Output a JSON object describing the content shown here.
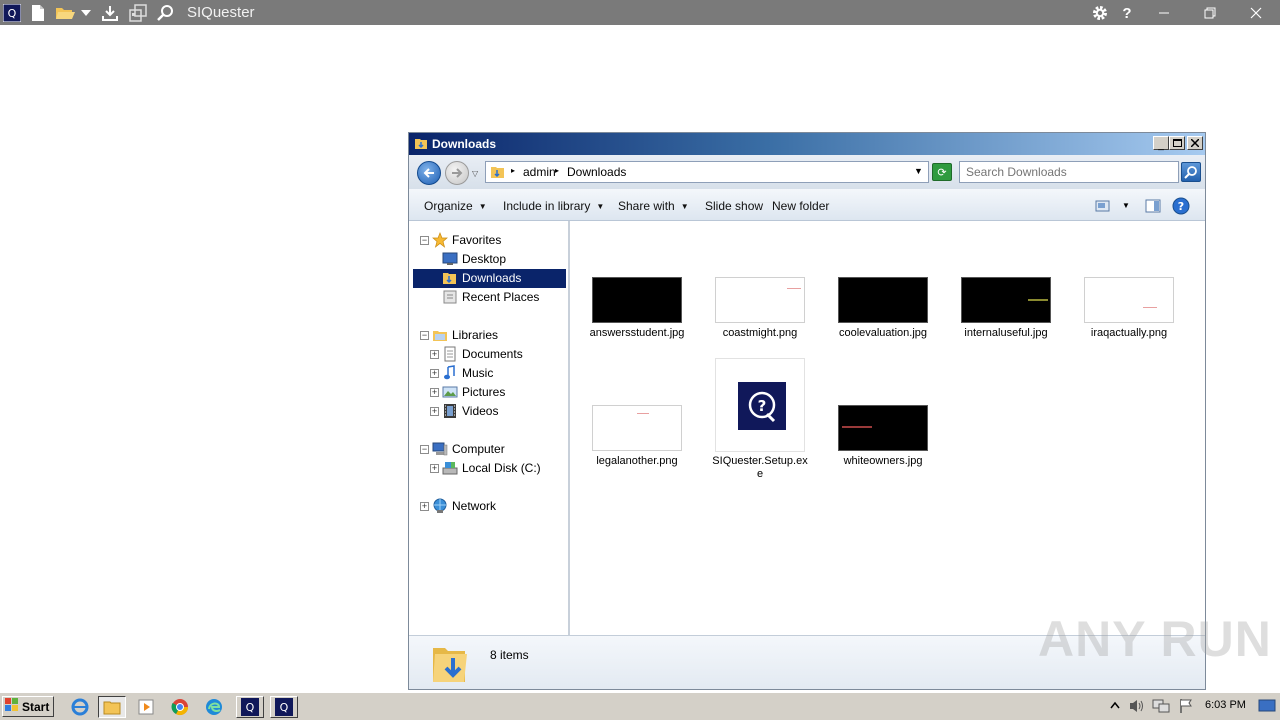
{
  "app": {
    "title": "SIQuester",
    "icons": [
      "siquester-logo-icon",
      "new-file-icon",
      "open-folder-icon",
      "chevron-down-icon",
      "download-icon",
      "import-icon",
      "search-icon"
    ],
    "right_icons": [
      "gear-icon",
      "help-icon",
      "minimize-icon",
      "restore-icon",
      "close-icon"
    ]
  },
  "explorer": {
    "title": "Downloads",
    "breadcrumb": [
      "admin",
      "Downloads"
    ],
    "search_placeholder": "Search Downloads",
    "commands": {
      "organize": "Organize",
      "include_in_library": "Include in library",
      "share_with": "Share with",
      "slide_show": "Slide show",
      "new_folder": "New folder"
    },
    "nav": {
      "favorites": "Favorites",
      "desktop": "Desktop",
      "downloads": "Downloads",
      "recent_places": "Recent Places",
      "libraries": "Libraries",
      "documents": "Documents",
      "music": "Music",
      "pictures": "Pictures",
      "videos": "Videos",
      "computer": "Computer",
      "local_disk": "Local Disk (C:)",
      "network": "Network"
    },
    "files": [
      {
        "name": "answersstudent.jpg",
        "thumb": "black"
      },
      {
        "name": "coastmight.png",
        "thumb": "white"
      },
      {
        "name": "coolevaluation.jpg",
        "thumb": "black"
      },
      {
        "name": "internaluseful.jpg",
        "thumb": "black"
      },
      {
        "name": "iraqactually.png",
        "thumb": "white"
      },
      {
        "name": "legalanother.png",
        "thumb": "white"
      },
      {
        "name": "SIQuester.Setup.exe",
        "thumb": "app"
      },
      {
        "name": "whiteowners.jpg",
        "thumb": "black"
      }
    ],
    "status": "8 items"
  },
  "taskbar": {
    "start_label": "Start",
    "clock": "6:03 PM"
  },
  "watermark": "ANY RUN",
  "colors": {
    "topbar": "#7a7a7a",
    "titlebar_start": "#0a246a",
    "selection": "#0a246a",
    "taskbar": "#d4d0c8"
  }
}
